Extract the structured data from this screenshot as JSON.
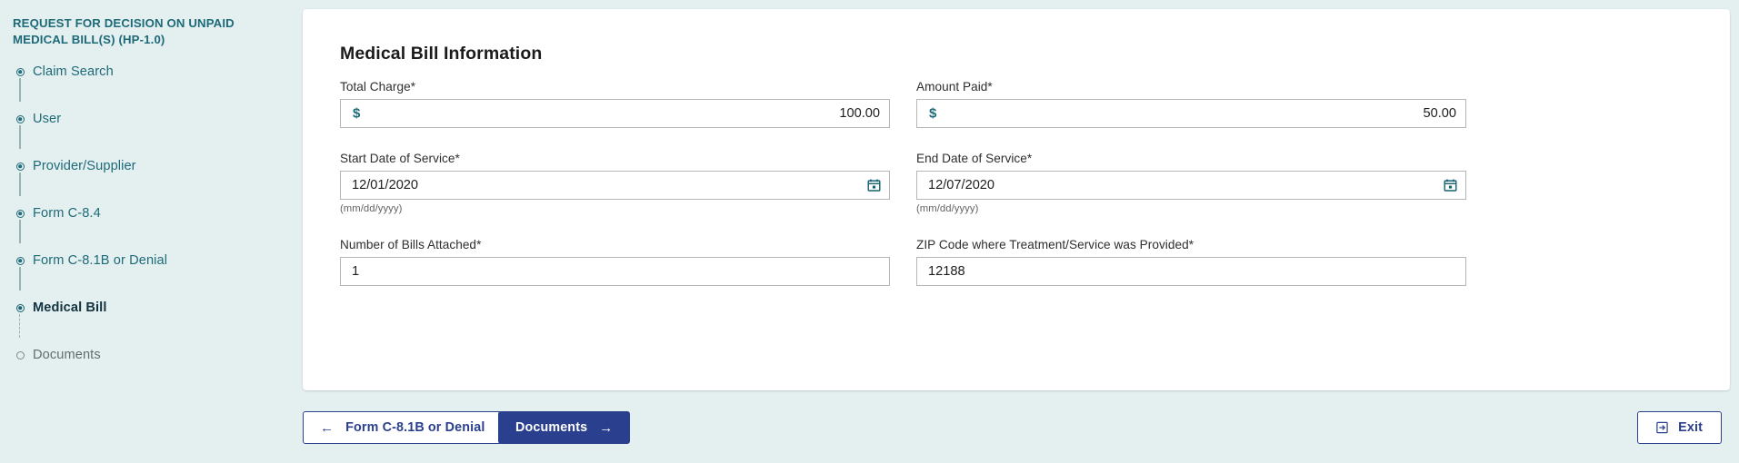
{
  "sidebar": {
    "title": "REQUEST FOR DECISION ON UNPAID MEDICAL BILL(S) (HP-1.0)",
    "steps": [
      {
        "label": "Claim Search",
        "state": "done"
      },
      {
        "label": "User",
        "state": "done"
      },
      {
        "label": "Provider/Supplier",
        "state": "done"
      },
      {
        "label": "Form C-8.4",
        "state": "done"
      },
      {
        "label": "Form C-8.1B or Denial",
        "state": "done"
      },
      {
        "label": "Medical Bill",
        "state": "current"
      },
      {
        "label": "Documents",
        "state": "inactive"
      }
    ]
  },
  "card": {
    "title": "Medical Bill Information",
    "fields": {
      "total_charge": {
        "label": "Total Charge",
        "required_mark": "*",
        "prefix": "$",
        "value": "100.00",
        "placeholder": ""
      },
      "amount_paid": {
        "label": "Amount Paid",
        "required_mark": "*",
        "prefix": "$",
        "value": "50.00",
        "placeholder": ""
      },
      "start_date": {
        "label": "Start Date of Service",
        "required_mark": "*",
        "value": "12/01/2020",
        "placeholder": "mm/dd/yyyy",
        "hint": "(mm/dd/yyyy)",
        "icon": "calendar-icon"
      },
      "end_date": {
        "label": "End Date of Service",
        "required_mark": "*",
        "value": "12/07/2020",
        "placeholder": "mm/dd/yyyy",
        "hint": "(mm/dd/yyyy)",
        "icon": "calendar-icon"
      },
      "bills_attached": {
        "label": "Number of Bills Attached",
        "required_mark": "*",
        "value": "1",
        "placeholder": ""
      },
      "zip_code": {
        "label": "ZIP Code where Treatment/Service was Provided",
        "required_mark": "*",
        "value": "12188",
        "placeholder": ""
      }
    }
  },
  "footer": {
    "previous_label": "Form C-8.1B or Denial",
    "previous_icon": "arrow-left-icon",
    "next_label": "Documents",
    "next_icon": "arrow-right-icon",
    "exit_label": "Exit",
    "exit_icon": "exit-icon"
  },
  "colors": {
    "page_background": "#e4eff0",
    "sidebar_accent": "#1d6a78",
    "active_step": "#12333f",
    "inactive_step": "#636d70",
    "primary_button": "#2b3f8f",
    "card_background": "#ffffff",
    "input_border": "#b6b6b6"
  }
}
